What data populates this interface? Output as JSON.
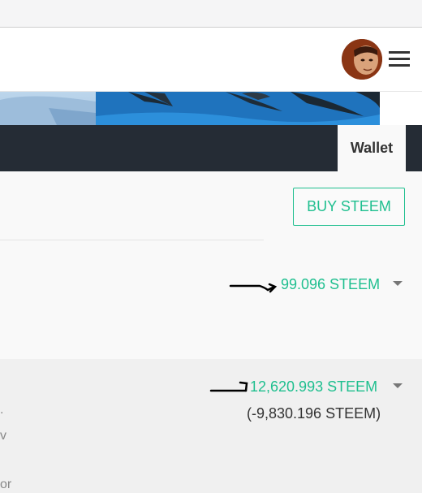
{
  "header": {
    "avatar_icon": "user-avatar",
    "menu_icon": "hamburger-menu-icon"
  },
  "tabs": {
    "active_label": "Wallet"
  },
  "wallet": {
    "buy_button_label": "BUY STEEM",
    "steem_balance": "99.096 STEEM",
    "steem_power": "12,620.993 STEEM",
    "steem_power_delegated": "(-9,830.196 STEEM)",
    "cut_text_1": ".",
    "cut_text_2": "v",
    "cut_text_3": "or",
    "accent_color": "#1fbf8f"
  }
}
